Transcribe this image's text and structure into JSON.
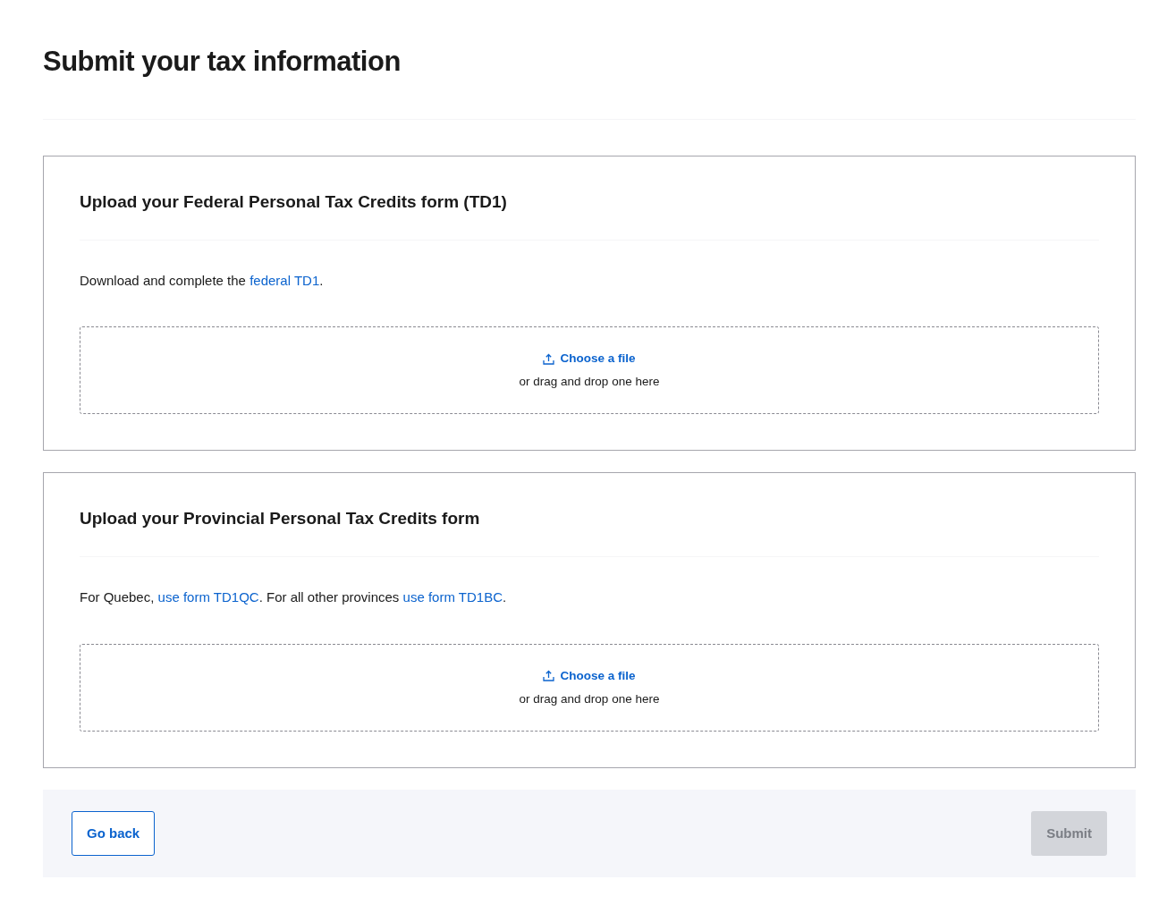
{
  "page": {
    "title": "Submit your tax information"
  },
  "sections": [
    {
      "heading": "Upload your Federal Personal Tax Credits form (TD1)",
      "instructions": [
        {
          "kind": "text",
          "text": "Download and complete the "
        },
        {
          "kind": "link",
          "text": "federal TD1"
        },
        {
          "kind": "text",
          "text": "."
        }
      ],
      "upload": {
        "button": "Choose a file",
        "hint": "or drag and drop one here"
      }
    },
    {
      "heading": "Upload your Provincial Personal Tax Credits form",
      "instructions": [
        {
          "kind": "text",
          "text": "For Quebec, "
        },
        {
          "kind": "link",
          "text": "use form TD1QC"
        },
        {
          "kind": "text",
          "text": ". For all other provinces "
        },
        {
          "kind": "link",
          "text": "use form TD1BC"
        },
        {
          "kind": "text",
          "text": "."
        }
      ],
      "upload": {
        "button": "Choose a file",
        "hint": "or drag and drop one here"
      }
    }
  ],
  "footer": {
    "back": {
      "label": "Go back",
      "disabled": false
    },
    "submit": {
      "label": "Submit",
      "disabled": true
    }
  }
}
